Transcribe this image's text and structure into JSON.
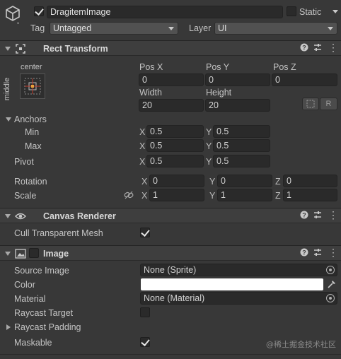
{
  "gameobject": {
    "name": "DragitemImage",
    "active": true,
    "static_label": "Static",
    "static": false,
    "tag_label": "Tag",
    "tag_value": "Untagged",
    "layer_label": "Layer",
    "layer_value": "UI"
  },
  "rect_transform": {
    "title": "Rect Transform",
    "anchor_preset_h": "center",
    "anchor_preset_v": "middle",
    "pos_x_label": "Pos X",
    "pos_y_label": "Pos Y",
    "pos_z_label": "Pos Z",
    "pos_x": "0",
    "pos_y": "0",
    "pos_z": "0",
    "width_label": "Width",
    "height_label": "Height",
    "width": "20",
    "height": "20",
    "raw_button": "R",
    "anchors_label": "Anchors",
    "min_label": "Min",
    "max_label": "Max",
    "pivot_label": "Pivot",
    "min": {
      "x": "0.5",
      "y": "0.5"
    },
    "max": {
      "x": "0.5",
      "y": "0.5"
    },
    "pivot": {
      "x": "0.5",
      "y": "0.5"
    },
    "rotation_label": "Rotation",
    "rotation": {
      "x": "0",
      "y": "0",
      "z": "0"
    },
    "scale_label": "Scale",
    "scale": {
      "x": "1",
      "y": "1",
      "z": "1"
    },
    "axis_x": "X",
    "axis_y": "Y",
    "axis_z": "Z"
  },
  "canvas_renderer": {
    "title": "Canvas Renderer",
    "cull_label": "Cull Transparent Mesh",
    "cull": true
  },
  "image": {
    "title": "Image",
    "enabled": false,
    "source_image_label": "Source Image",
    "source_image": "None (Sprite)",
    "color_label": "Color",
    "color": "#ffffff",
    "material_label": "Material",
    "material": "None (Material)",
    "raycast_target_label": "Raycast Target",
    "raycast_target": false,
    "raycast_padding_label": "Raycast Padding",
    "maskable_label": "Maskable",
    "maskable": true
  },
  "watermark": "@稀土掘金技术社区"
}
